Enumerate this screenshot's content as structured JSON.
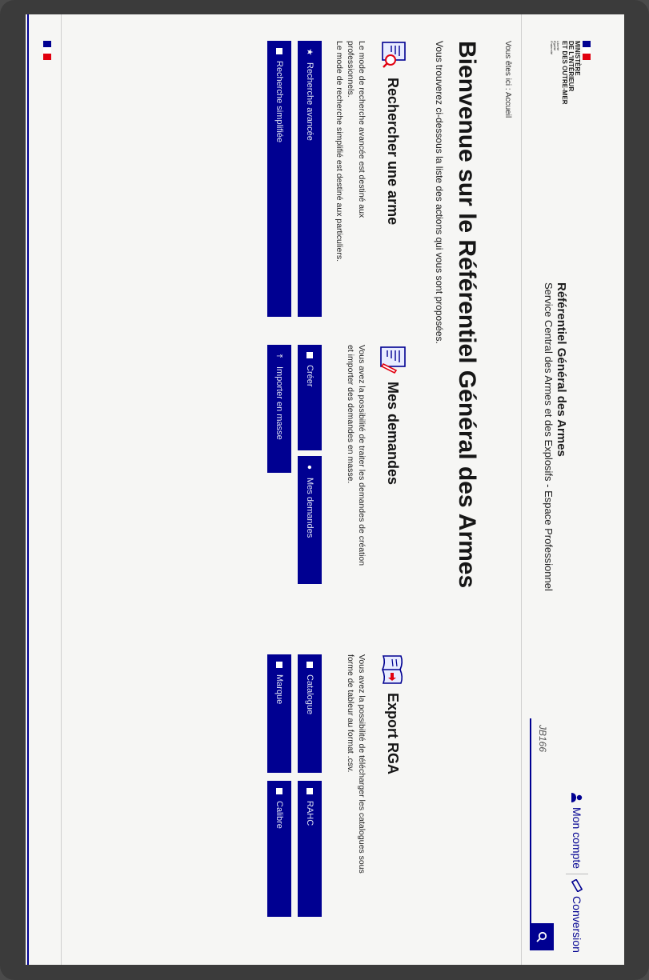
{
  "header": {
    "ministry_lines": [
      "MINISTÈRE",
      "DE L'INTÉRIEUR",
      "ET DES OUTRE-MER"
    ],
    "devise_lines": [
      "Liberté",
      "Égalité",
      "Fraternité"
    ],
    "site_title": "Référentiel Général des Armes",
    "site_subtitle": "Service Central des Armes et des Explosifs - Espace Professionnel",
    "account_label": "Mon compte",
    "conversion_label": "Conversion",
    "search_value": "JB166"
  },
  "breadcrumb": {
    "prefix": "Vous êtes ici :",
    "current": "Accueil"
  },
  "main": {
    "heading": "Bienvenue sur le Référentiel Général des Armes",
    "intro": "Vous trouverez ci-dessous la liste des actions qui vous sont proposées."
  },
  "cards": [
    {
      "title": "Rechercher une arme",
      "icon": "document-search-icon",
      "desc_lines": [
        "Le mode de recherche avancée est destiné aux",
        "professionnels.",
        "Le mode de recherche simplifié est destiné aux particuliers."
      ],
      "buttons": [
        {
          "label": "Recherche avancée",
          "icon": "star-icon"
        },
        {
          "label": "Recherche simplifiée",
          "icon": "square-icon"
        }
      ]
    },
    {
      "title": "Mes demandes",
      "icon": "document-edit-icon",
      "desc_lines": [
        "Vous avez la possibilité de traiter les demandes de création",
        "et importer des demandes en masse."
      ],
      "buttons": [
        {
          "label": "Créer",
          "icon": "square-icon"
        },
        {
          "label": "Mes demandes",
          "icon": "circle-icon"
        },
        {
          "label": "Importer en masse",
          "icon": "upload-icon"
        }
      ]
    },
    {
      "title": "Export RGA",
      "icon": "open-book-icon",
      "desc_lines": [
        "Vous avez la possibilité de télécharger les catalogues sous",
        "forme de tableur au format .csv."
      ],
      "buttons": [
        {
          "label": "Catalogue",
          "icon": "square-icon"
        },
        {
          "label": "RAHC",
          "icon": "square-icon"
        },
        {
          "label": "Marque",
          "icon": "square-icon"
        },
        {
          "label": "Calibre",
          "icon": "square-icon"
        }
      ]
    }
  ],
  "colors": {
    "primary_blue": "#000091",
    "flag_red": "#e1000f",
    "paper": "#f6f6f4",
    "background": "#3b3b3b"
  }
}
